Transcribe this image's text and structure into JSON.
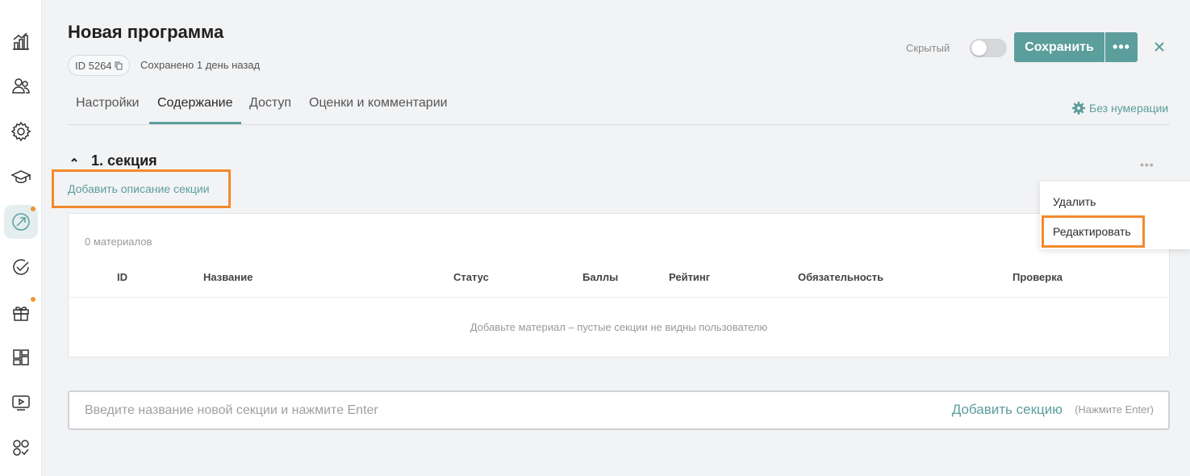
{
  "header": {
    "title": "Новая программа",
    "id_label": "ID 5264",
    "saved_text": "Сохранено 1 день назад",
    "hidden_label": "Скрытый",
    "save_label": "Сохранить",
    "more_label": "•••"
  },
  "tabs": [
    {
      "label": "Настройки"
    },
    {
      "label": "Содержание"
    },
    {
      "label": "Доступ"
    },
    {
      "label": "Оценки и комментарии"
    }
  ],
  "numbering_label": "Без нумерации",
  "section": {
    "title": "1. секция",
    "add_description": "Добавить описание секции",
    "dots": "•••",
    "materials_count": "0 материалов",
    "columns": [
      "ID",
      "Название",
      "Статус",
      "Баллы",
      "Рейтинг",
      "Обязательность",
      "Проверка"
    ],
    "empty_text": "Добавьте материал – пустые секции не видны пользователю"
  },
  "menu": {
    "delete": "Удалить",
    "edit": "Редактировать"
  },
  "new_section": {
    "placeholder": "Введите название новой секции и нажмите Enter",
    "add_label": "Добавить секцию",
    "hint": "(Нажмите Enter)"
  },
  "colors": {
    "accent": "#5b9e9b",
    "highlight": "#f38a2c",
    "notification_dot": "#f0952f"
  },
  "sidebar_icons": [
    "analytics-icon",
    "users-icon",
    "settings-icon",
    "education-icon",
    "programs-icon",
    "tasks-icon",
    "gifts-icon",
    "dashboard-icon",
    "video-icon",
    "apps-icon"
  ]
}
